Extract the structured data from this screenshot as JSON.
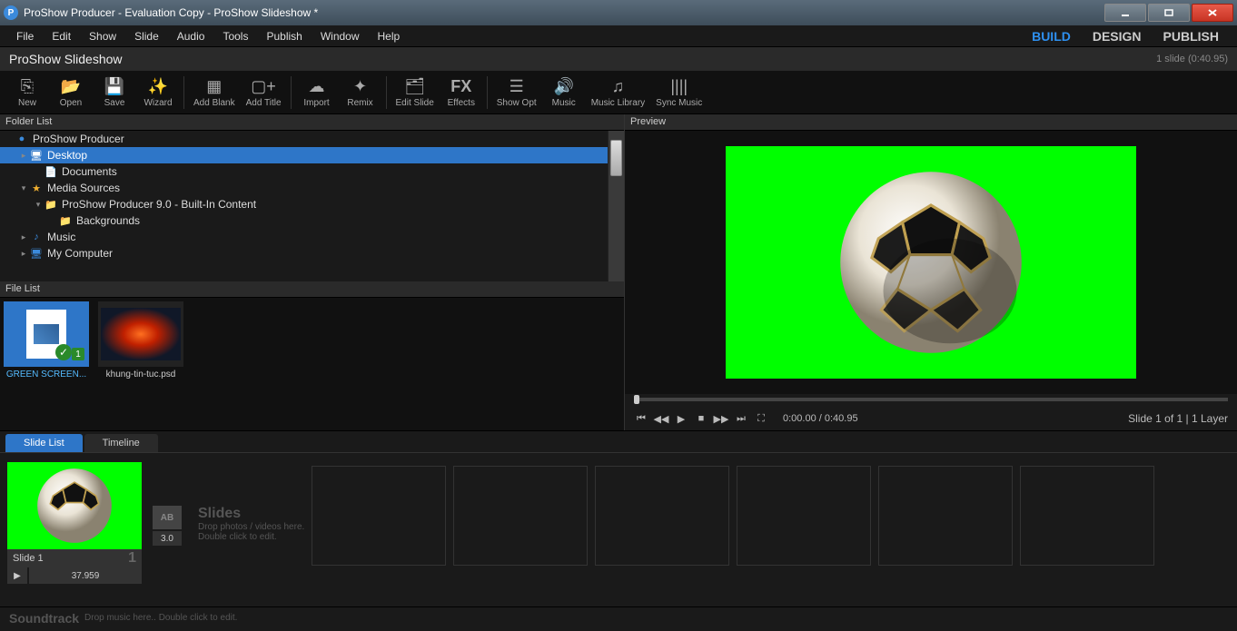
{
  "window": {
    "title": "ProShow Producer - Evaluation Copy - ProShow Slideshow *"
  },
  "menu": {
    "items": [
      "File",
      "Edit",
      "Show",
      "Slide",
      "Audio",
      "Tools",
      "Publish",
      "Window",
      "Help"
    ],
    "modes": [
      "BUILD",
      "DESIGN",
      "PUBLISH"
    ],
    "active_mode": 0
  },
  "showbar": {
    "name": "ProShow Slideshow",
    "info": "1 slide (0:40.95)"
  },
  "toolbar": [
    {
      "label": "New",
      "glyph": "⎘"
    },
    {
      "label": "Open",
      "glyph": "📂"
    },
    {
      "label": "Save",
      "glyph": "💾"
    },
    {
      "label": "Wizard",
      "glyph": "✨"
    },
    null,
    {
      "label": "Add Blank",
      "glyph": "▦"
    },
    {
      "label": "Add Title",
      "glyph": "▢+"
    },
    null,
    {
      "label": "Import",
      "glyph": "☁"
    },
    {
      "label": "Remix",
      "glyph": "✦"
    },
    null,
    {
      "label": "Edit Slide",
      "glyph": "🗂"
    },
    {
      "label": "Effects",
      "glyph": "FX",
      "big": true
    },
    null,
    {
      "label": "Show Opt",
      "glyph": "☰"
    },
    {
      "label": "Music",
      "glyph": "🔊"
    },
    {
      "label": "Music Library",
      "glyph": "♫"
    },
    {
      "label": "Sync Music",
      "glyph": "||||"
    }
  ],
  "panels": {
    "folder": "Folder List",
    "file": "File List",
    "preview": "Preview"
  },
  "tree": [
    {
      "indent": 0,
      "arrow": "",
      "icon": "●",
      "label": "ProShow Producer",
      "iconcolor": "#3b8adb"
    },
    {
      "indent": 1,
      "arrow": "▸",
      "icon": "🖥",
      "label": "Desktop",
      "selected": true
    },
    {
      "indent": 2,
      "arrow": "",
      "icon": "📄",
      "label": "Documents"
    },
    {
      "indent": 1,
      "arrow": "▾",
      "icon": "★",
      "label": "Media Sources",
      "iconcolor": "#f0b030"
    },
    {
      "indent": 2,
      "arrow": "▾",
      "icon": "📁",
      "label": "ProShow Producer 9.0 - Built-In Content",
      "iconcolor": "#f0b030"
    },
    {
      "indent": 3,
      "arrow": "",
      "icon": "📁",
      "label": "Backgrounds",
      "iconcolor": "#f0b030"
    },
    {
      "indent": 1,
      "arrow": "▸",
      "icon": "♪",
      "label": "Music",
      "iconcolor": "#3b8adb"
    },
    {
      "indent": 1,
      "arrow": "▸",
      "icon": "🖥",
      "label": "My Computer",
      "iconcolor": "#3b8adb"
    }
  ],
  "files": [
    {
      "name": "GREEN SCREEN...",
      "selected": true,
      "kind": "video"
    },
    {
      "name": "khung-tin-tuc.psd",
      "selected": false,
      "kind": "psd"
    }
  ],
  "player": {
    "time": "0:00.00 / 0:40.95",
    "status": "Slide 1 of 1  |  1 Layer"
  },
  "bottom_tabs": {
    "items": [
      "Slide List",
      "Timeline"
    ],
    "active": 0
  },
  "slide": {
    "label": "Slide 1",
    "number": "1",
    "duration": "37.959",
    "trans": "3.0",
    "slides_title": "Slides",
    "slides_hint1": "Drop photos / videos here.",
    "slides_hint2": "Double click to edit."
  },
  "soundtrack": {
    "label": "Soundtrack",
    "hint": "Drop music here.. Double click to edit."
  }
}
